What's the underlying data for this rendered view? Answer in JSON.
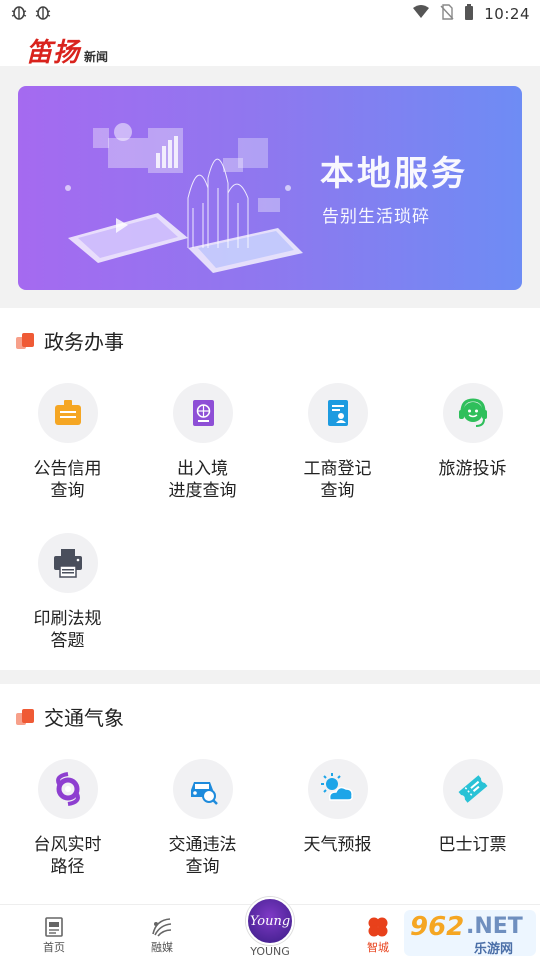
{
  "status_bar": {
    "left_icons": [
      "bug-icon",
      "bug-icon"
    ],
    "right_icons": [
      "wifi-icon",
      "no-sim-icon",
      "battery-icon"
    ],
    "time": "10:24"
  },
  "header": {
    "logo_main": "笛扬",
    "logo_sub": "新闻"
  },
  "banner": {
    "title": "本地服务",
    "subtitle": "告别生活琐碎"
  },
  "sections": [
    {
      "title": "政务办事",
      "items": [
        {
          "label": "公告信用\n查询",
          "icon": "announcement-icon"
        },
        {
          "label": "出入境\n进度查询",
          "icon": "passport-icon"
        },
        {
          "label": "工商登记\n查询",
          "icon": "registration-card-icon"
        },
        {
          "label": "旅游投诉",
          "icon": "customer-service-icon"
        },
        {
          "label": "印刷法规\n答题",
          "icon": "printer-icon"
        }
      ]
    },
    {
      "title": "交通气象",
      "items": [
        {
          "label": "台风实时\n路径",
          "icon": "typhoon-icon"
        },
        {
          "label": "交通违法\n查询",
          "icon": "car-search-icon"
        },
        {
          "label": "天气预报",
          "icon": "weather-icon"
        },
        {
          "label": "巴士订票",
          "icon": "ticket-icon"
        }
      ]
    }
  ],
  "bottom_nav": [
    {
      "label": "首页",
      "icon": "home-doc-icon"
    },
    {
      "label": "融媒",
      "icon": "media-icon"
    },
    {
      "label": "YOUNG",
      "icon": "young-logo-icon"
    },
    {
      "label": "智城",
      "icon": "smart-city-icon"
    }
  ],
  "watermark": {
    "number": "962",
    "net": ".NET",
    "site_cn": "乐游网"
  },
  "colors": {
    "accent_red": "#e8411b",
    "banner_start": "#a56af0",
    "banner_end": "#6e8cf4"
  }
}
